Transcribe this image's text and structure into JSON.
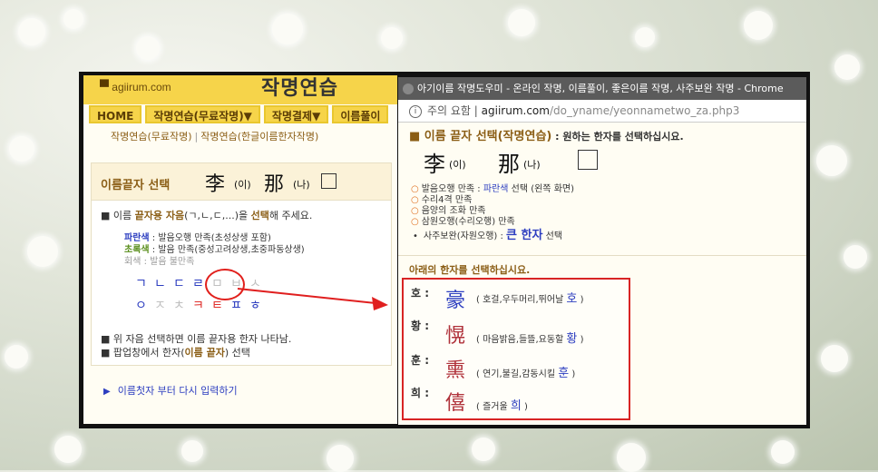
{
  "left_site": {
    "logo": "agiirum.com",
    "logo_title": "작명연습",
    "menu": [
      "HOME",
      "작명연습(무료작명)▼",
      "작명결제▼",
      "이름풀이"
    ],
    "submenu": [
      "작명연습(무료작명)",
      "작명연습(한글이름한자작명)"
    ],
    "box_title": "이름끝자 선택",
    "name1_hanja": "李",
    "name1_read": "(이)",
    "name2_hanja": "那",
    "name2_read": "(나)",
    "instruction_pre": "■ 이름 ",
    "instruction_bold1": "끝자용 자음",
    "instruction_mid": "(ㄱ,ㄴ,ㄷ,...)을 ",
    "instruction_bold2": "선택",
    "instruction_post": "해 주세요.",
    "legend": [
      {
        "color": "파란색",
        "text": " : 발음오행 만족(초성상생 포함)"
      },
      {
        "color": "초록색",
        "text": " : 발음 만족(중성고려상생,초중파동상생)"
      },
      {
        "color": "회색",
        "text": " : 발음 불만족"
      }
    ],
    "jamo_row1": [
      "ㄱ",
      "ㄴ",
      "ㄷ",
      "ㄹ",
      "ㅁ",
      "ㅂ",
      "ㅅ"
    ],
    "jamo_row2": [
      "ㅇ",
      "ㅈ",
      "ㅊ",
      "ㅋ",
      "ㅌ",
      "ㅍ",
      "ㅎ"
    ],
    "note1": "■ 위 자음 선택하면 이름 끝자용 한자 나타남.",
    "note2_pre": "■ 팝업창에서 한자(",
    "note2_bold": "이름 끝자",
    "note2_post": ") 선택",
    "restart": "이름첫자 부터 다시 입력하기"
  },
  "popup": {
    "window_title": "아기이름 작명도우미 - 온라인 작명, 이름풀이, 좋은이름 작명, 사주보완 작명 - Chrome",
    "url_warning": "주의 요함",
    "url_host": "agiirum.com",
    "url_path": "/do_yname/yeonnametwo_za.php3",
    "heading": "■ 이름 끝자 선택(작명연습)",
    "heading_sub": " : 원하는 한자를 선택하십시요.",
    "name1_hanja": "李",
    "name1_read": "(이)",
    "name2_hanja": "那",
    "name2_read": "(나)",
    "checks": [
      {
        "mark": "○",
        "text": "발음오행 만족 : ",
        "blue": "파란색",
        "tail": " 선택 (왼쪽 화면)"
      },
      {
        "mark": "○",
        "text": "수리4격 만족",
        "blue": "",
        "tail": ""
      },
      {
        "mark": "○",
        "text": "음양의 조화 만족",
        "blue": "",
        "tail": ""
      },
      {
        "mark": "○",
        "text": "삼원오행(수리오행) 만족",
        "blue": "",
        "tail": ""
      }
    ],
    "saju_pre": "사주보완(자원오행) : ",
    "saju_big": "큰 한자",
    "saju_post": " 선택",
    "choose": "아래의 한자를 선택하십시요.",
    "hanja_list": [
      {
        "label": "호 :",
        "hanja": "豪",
        "meaning": "( 호걸,우두머리,뛰어날 ",
        "sound": "호",
        "close": " )"
      },
      {
        "label": "황 :",
        "hanja": "愰",
        "meaning": "( 마음밝음,들뜰,요동할 ",
        "sound": "황",
        "close": " )"
      },
      {
        "label": "훈 :",
        "hanja": "熏",
        "meaning": "( 연기,불길,감동시킬 ",
        "sound": "훈",
        "close": " )"
      },
      {
        "label": "희 :",
        "hanja": "僖",
        "meaning": "( 즐거울 ",
        "sound": "희",
        "close": " )"
      }
    ]
  },
  "colors": {
    "accent_red": "#d82424",
    "menu_yellow": "#f6d44a",
    "blue": "#2d3ec0",
    "brown": "#8b5e16"
  }
}
